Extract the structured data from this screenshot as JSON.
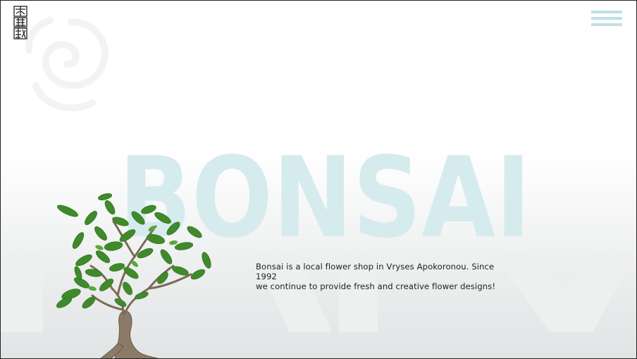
{
  "header": {
    "logo_icon": "bonsai-kanji-logo-icon",
    "menu_icon": "hamburger-menu-icon"
  },
  "hero": {
    "title": "BONSAI",
    "tagline_line1": "Bonsai is a local flower shop in Vryses Apokoronou. Since 1992",
    "tagline_line2": "we continue to provide fresh and creative flower designs!"
  },
  "colors": {
    "title": "#d6ebee",
    "menu": "#bfe0e4",
    "text": "#1e1e1e",
    "leaf": "#3f8a2a"
  }
}
